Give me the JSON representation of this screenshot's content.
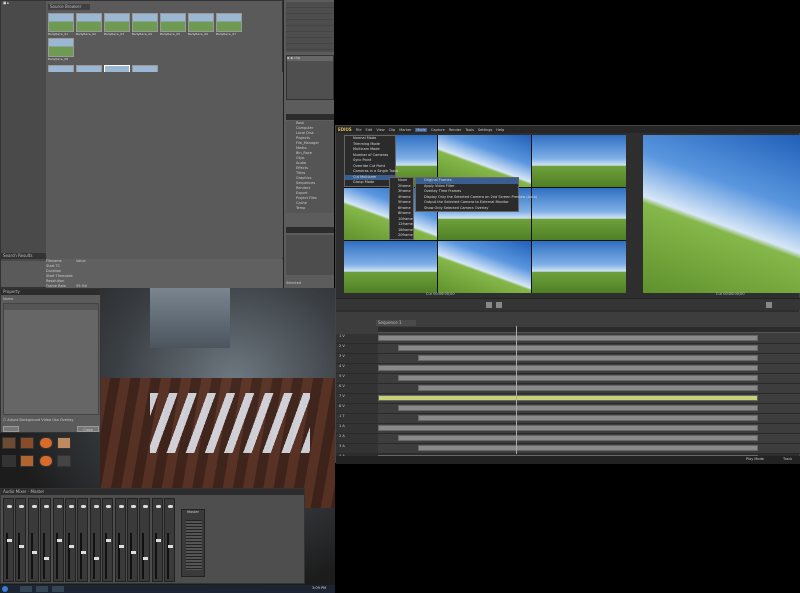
{
  "bin_window": {
    "title": "Source Browser",
    "thumbnails": [
      {
        "label": "BallyRace_01"
      },
      {
        "label": "BallyRace_02"
      },
      {
        "label": "BallyRace_03"
      },
      {
        "label": "BallyRace_04"
      },
      {
        "label": "BallyRace_05"
      },
      {
        "label": "BallyRace_06"
      },
      {
        "label": "BallyRace_07"
      },
      {
        "label": "BallyRace_08"
      },
      {
        "label": "BallyRace_09"
      },
      {
        "label": "BallyRace_10"
      },
      {
        "label": "BallyRace_11"
      },
      {
        "label": "BallyRace_12"
      }
    ],
    "properties": [
      {
        "k": "Filename",
        "v": "Value"
      },
      {
        "k": "Start TC",
        "v": ""
      },
      {
        "k": "Duration",
        "v": ""
      },
      {
        "k": "Start Timecode",
        "v": ""
      },
      {
        "k": "Resolution",
        "v": ""
      },
      {
        "k": "Frame Rate",
        "v": "59.94i"
      },
      {
        "k": "Codec",
        "v": ""
      }
    ],
    "search_tab": "Search Results"
  },
  "side_panel": {
    "tree_items": [
      "Root",
      "Computer",
      "Local Disk",
      "Projects",
      "File_Manager",
      "Media",
      "Bin_Race",
      "Clips",
      "Audio",
      "Effects",
      "Titles",
      "Graphics",
      "Sequences",
      "Renders",
      "Export",
      "Project Files",
      "Cache",
      "Temp"
    ],
    "list_items": [
      "Video",
      "Audio"
    ],
    "bottom_label": "Selected"
  },
  "editor": {
    "app_name": "EDIUS",
    "menubar": [
      "File",
      "Edit",
      "View",
      "Clip",
      "Marker",
      "Mode",
      "Capture",
      "Render",
      "Tools",
      "Settings",
      "Help"
    ],
    "context_menu": [
      "Normal Mode",
      "Trimming Mode",
      "Multicam Mode",
      "Number of Cameras",
      "Sync Point",
      "Override Cut Point",
      "Cameras in a Single Track",
      "Cut Multicam",
      "Group Mode"
    ],
    "submenu": [
      "None",
      "2frame",
      "3frame",
      "4frame",
      "5frame",
      "6frame",
      "8frame",
      "10frame",
      "12frame",
      "16frame",
      "20frame"
    ],
    "submenu2": [
      "Original Frames",
      "Apply Video Filter",
      "Overlay Time Frames",
      "Display Only the Selected Camera on 2nd Screen Preview (Auto)",
      "Output the Selected Camera to External Monitor",
      "Show Only Selected Camera Overlay"
    ],
    "timecode_left": "Cur 00:00:00;00",
    "timecode_right": "Cur 00:00:00;00",
    "timeline_tab": "Sequence 1",
    "track_labels": [
      "1 V",
      "2 V",
      "3 V",
      "4 V",
      "5 V",
      "6 V",
      "7 V",
      "8 V",
      "1 T",
      "1 A",
      "2 A",
      "3 A",
      "4 A"
    ],
    "status_left": "Play Mode",
    "status_right": "Track"
  },
  "dialog": {
    "title": "Property",
    "field": "Name",
    "checkbox": "Adjust Background Video Use Overlay",
    "button": "Close"
  },
  "mixer": {
    "title": "Audio Mixer - Master",
    "channels": 14,
    "master_label": "Master"
  },
  "taskbar": {
    "clock": "3:09 PM"
  }
}
